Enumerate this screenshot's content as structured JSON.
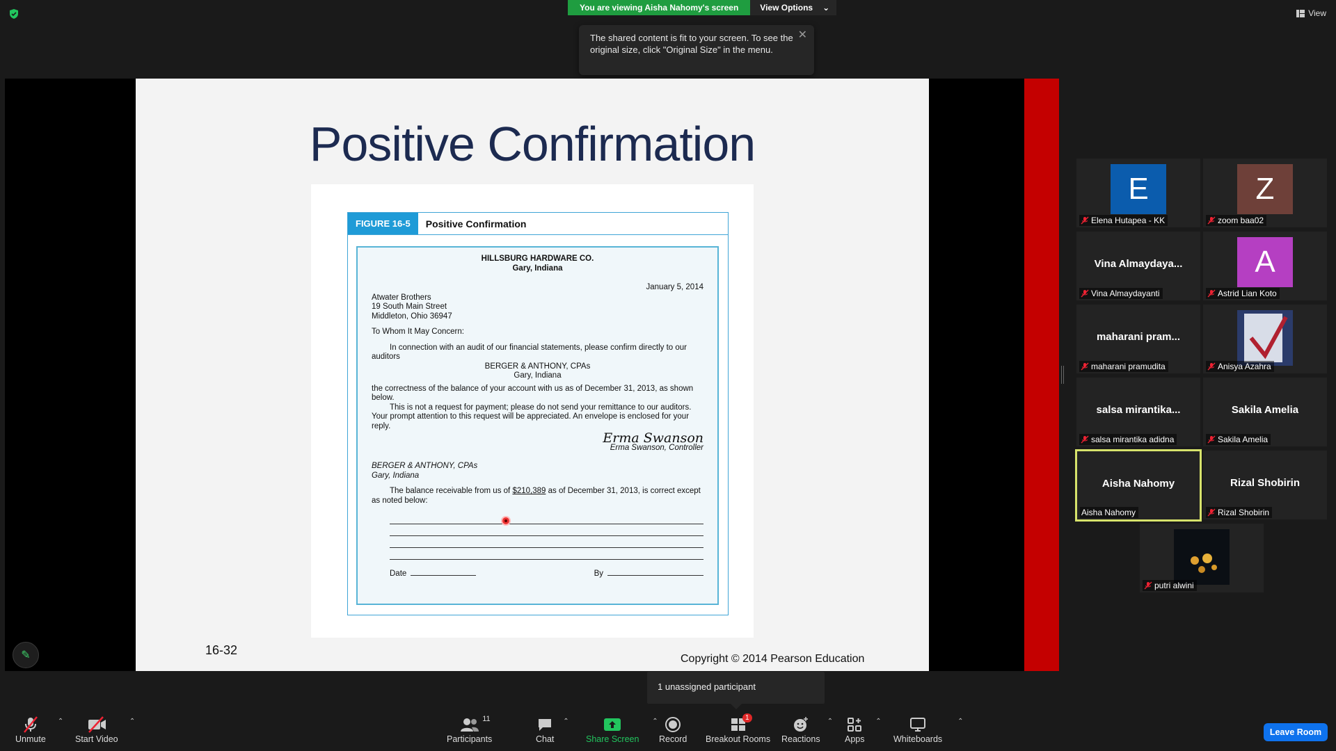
{
  "top": {
    "viewing_banner": "You are viewing Aisha Nahomy's screen",
    "view_options": "View Options",
    "view": "View",
    "tooltip": "The shared content is fit to your screen. To see the original size, click \"Original Size\" in the menu."
  },
  "slide": {
    "title": "Positive Confirmation",
    "figure_label": "FIGURE 16-5",
    "figure_title": "Positive Confirmation",
    "company": "HILLSBURG HARDWARE CO.",
    "company_city": "Gary, Indiana",
    "date": "January 5, 2014",
    "addr1": "Atwater Brothers",
    "addr2": "19 South Main Street",
    "addr3": "Middleton, Ohio 36947",
    "salutation": "To Whom It May Concern:",
    "para1": "In connection with an audit of our financial statements, please confirm directly to our auditors",
    "auditor": "BERGER & ANTHONY, CPAs",
    "auditor_city": "Gary, Indiana",
    "para2": "the correctness of the balance of your account with us as of December 31, 2013, as shown below.",
    "para3": "This is not a request for payment; please do not send your remittance to our auditors. Your prompt attention to this request will be appreciated. An envelope is enclosed for your reply.",
    "signature": "Erma Swanson",
    "signer": "Erma Swanson, Controller",
    "reply_to": "BERGER & ANTHONY, CPAs",
    "reply_city": "Gary, Indiana",
    "balance_pre": "The balance receivable from us of",
    "balance_amount": "$210,389",
    "balance_post": "as of December 31, 2013, is correct except as noted below:",
    "date_label": "Date",
    "by_label": "By",
    "slide_number": "16-32",
    "copyright": "Copyright © 2014 Pearson Education"
  },
  "gallery": [
    {
      "label": "Elena Hutapea - KK",
      "avatar_letter": "E",
      "avatar_color": "#0b5cad"
    },
    {
      "label": "zoom baa02",
      "avatar_letter": "Z",
      "avatar_color": "#6e4039"
    },
    {
      "label": "Vina Almaydayanti",
      "big_name": "Vina  Almaydaya..."
    },
    {
      "label": "Astrid Lian Koto",
      "avatar_letter": "A",
      "avatar_color": "#b53fc2"
    },
    {
      "label": "maharani pramudita",
      "big_name": "maharani  pram..."
    },
    {
      "label": "Anisya Azahra"
    },
    {
      "label": "salsa mirantika adidna",
      "big_name": "salsa  mirantika..."
    },
    {
      "label": "Sakila Amelia",
      "big_name": "Sakila Amelia"
    },
    {
      "label": "Aisha Nahomy",
      "big_name": "Aisha Nahomy"
    },
    {
      "label": "Rizal Shobirin",
      "big_name": "Rizal Shobirin"
    },
    {
      "label": "putri alwini"
    }
  ],
  "toolbar": {
    "unmute": "Unmute",
    "start_video": "Start Video",
    "participants": "Participants",
    "participants_count": "11",
    "chat": "Chat",
    "share_screen": "Share Screen",
    "record": "Record",
    "breakout_rooms": "Breakout Rooms",
    "breakout_badge": "1",
    "reactions": "Reactions",
    "apps": "Apps",
    "whiteboards": "Whiteboards",
    "leave_room": "Leave Room",
    "unassigned_tooltip": "1 unassigned participant"
  },
  "colors": {
    "accent_green": "#22c55e",
    "leave_blue": "#0e72ed",
    "active_speaker": "#d7e36b",
    "slide_red_bar": "#c40000"
  }
}
